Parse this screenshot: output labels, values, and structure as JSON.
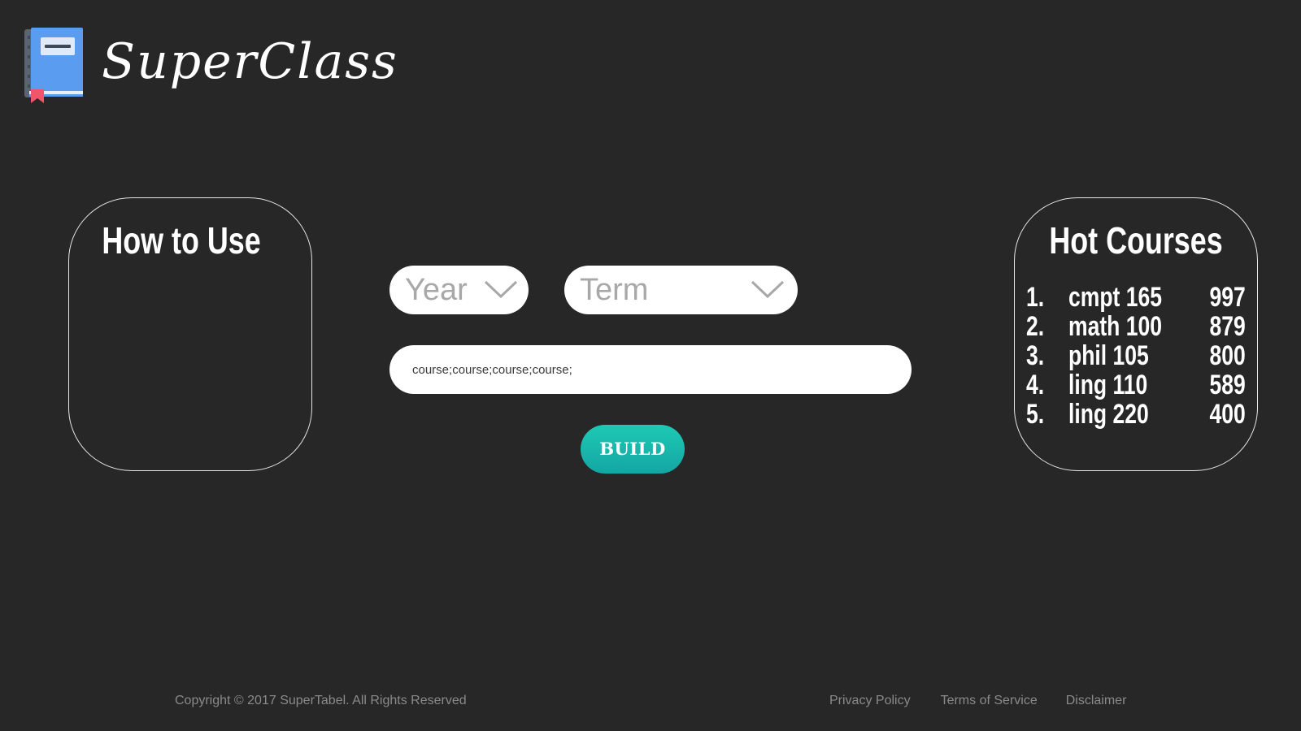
{
  "brand": {
    "name": "SuperClass",
    "icon": "book-icon",
    "icon_colors": {
      "cover": "#5a9df0",
      "spine": "#5b6470",
      "bookmark": "#f0556a",
      "label": "#dfe9f7"
    }
  },
  "how_to_use": {
    "title": "How to Use"
  },
  "form": {
    "year": {
      "label": "Year",
      "icon": "chevron-down-icon"
    },
    "term": {
      "label": "Term",
      "icon": "chevron-down-icon"
    },
    "courses_input": {
      "value": "course;course;course;course;",
      "placeholder": "course;course;course;course;"
    },
    "build_label": "BUILD",
    "build_color": "#17b8ac"
  },
  "hot_courses": {
    "title": "Hot Courses",
    "items": [
      {
        "rank": "1.",
        "name": "cmpt 165",
        "count": "997"
      },
      {
        "rank": "2.",
        "name": "math 100",
        "count": "879"
      },
      {
        "rank": "3.",
        "name": "phil 105",
        "count": "800"
      },
      {
        "rank": "4.",
        "name": "ling 110",
        "count": "589"
      },
      {
        "rank": "5.",
        "name": "ling 220",
        "count": "400"
      }
    ]
  },
  "footer": {
    "copyright": "Copyright © 2017 SuperTabel. All Rights Reserved",
    "links": [
      "Privacy Policy",
      "Terms of Service",
      "Disclaimer"
    ]
  },
  "colors": {
    "background": "#272727",
    "panel_border": "#e6e6e6",
    "footer_text": "#8a8a8a"
  }
}
